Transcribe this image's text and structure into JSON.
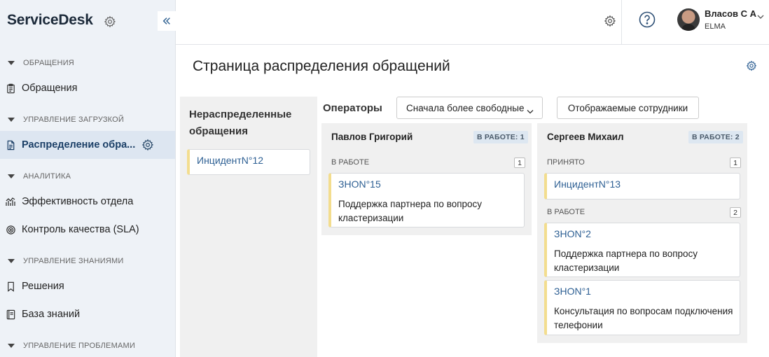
{
  "sidebar": {
    "brand": "ServiceDesk",
    "sections": [
      {
        "label": "ОБРАЩЕНИЯ"
      },
      {
        "label": "УПРАВЛЕНИЕ ЗАГРУЗКОЙ"
      },
      {
        "label": "АНАЛИТИКА"
      },
      {
        "label": "УПРАВЛЕНИЕ ЗНАНИЯМИ"
      },
      {
        "label": "УПРАВЛЕНИЕ ПРОБЛЕМАМИ"
      }
    ],
    "items": [
      {
        "label": "Обращения",
        "icon": "clipboard-icon"
      },
      {
        "label": "Распределение обра...",
        "icon": "document-icon",
        "active": true
      },
      {
        "label": "Эффективность отдела",
        "icon": "chart-icon"
      },
      {
        "label": "Контроль качества (SLA)",
        "icon": "target-icon"
      },
      {
        "label": "Решения",
        "icon": "bookmark-icon"
      },
      {
        "label": "База знаний",
        "icon": "book-icon"
      }
    ]
  },
  "header": {
    "user_name": "Власов С А",
    "user_org": "ELMA"
  },
  "main": {
    "title": "Страница распределения обращений",
    "unassigned": {
      "title": "Нераспределенные обращения",
      "cards": [
        {
          "link": "ИнцидентN°12"
        }
      ]
    },
    "operators_label": "Операторы",
    "sort_value": "Сначала более свободные",
    "shown_button": "Отображаемые сотрудники",
    "operators": [
      {
        "name": "Павлов Григорий",
        "badge": "В РАБОТЕ: 1",
        "groups": [
          {
            "label": "В РАБОТЕ",
            "count": "1",
            "cards": [
              {
                "link": "ЗНОN°15",
                "desc": "Поддержка партнера по вопросу кластеризации"
              }
            ]
          }
        ]
      },
      {
        "name": "Сергеев Михаил",
        "badge": "В РАБОТЕ: 2",
        "groups": [
          {
            "label": "ПРИНЯТО",
            "count": "1",
            "cards": [
              {
                "link": "ИнцидентN°13"
              }
            ]
          },
          {
            "label": "В РАБОТЕ",
            "count": "2",
            "cards": [
              {
                "link": "ЗНОN°2",
                "desc": "Поддержка партнера по вопросу кластеризации"
              },
              {
                "link": "ЗНОN°1",
                "desc": "Консультация по вопросам подключения телефонии"
              }
            ]
          }
        ]
      }
    ]
  },
  "colors": {
    "accent": "#2d5f93",
    "card_marker": "#f3dd8e",
    "sidebar_bg": "#eef2f7",
    "active_bg": "#dde6f1"
  }
}
